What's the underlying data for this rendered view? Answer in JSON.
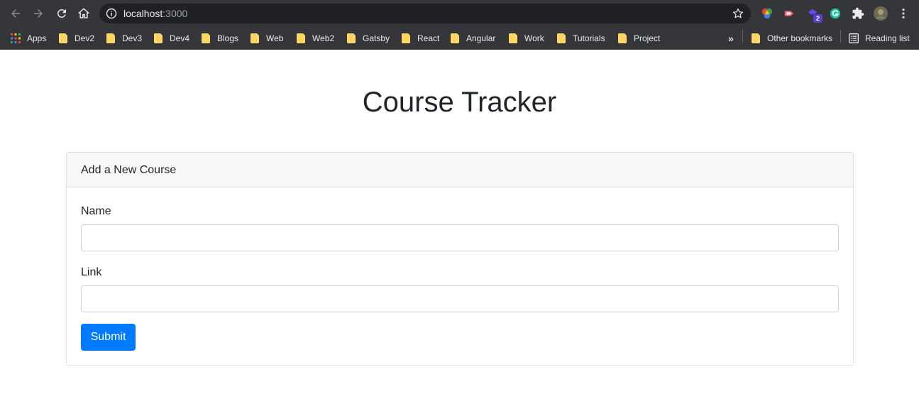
{
  "browser": {
    "url_host": "localhost",
    "url_port": ":3000",
    "extension_badge": "2",
    "bookmarks": [
      {
        "label": "Apps"
      },
      {
        "label": "Dev2"
      },
      {
        "label": "Dev3"
      },
      {
        "label": "Dev4"
      },
      {
        "label": "Blogs"
      },
      {
        "label": "Web"
      },
      {
        "label": "Web2"
      },
      {
        "label": "Gatsby"
      },
      {
        "label": "React"
      },
      {
        "label": "Angular"
      },
      {
        "label": "Work"
      },
      {
        "label": "Tutorials"
      },
      {
        "label": "Project"
      }
    ],
    "overflow_chevron": "»",
    "other_bookmarks": "Other bookmarks",
    "reading_list": "Reading list"
  },
  "page": {
    "title": "Course Tracker"
  },
  "form": {
    "header": "Add a New Course",
    "name_label": "Name",
    "name_value": "",
    "link_label": "Link",
    "link_value": "",
    "submit_label": "Submit"
  },
  "colors": {
    "chrome_bg": "#35363a",
    "omnibox_bg": "#202124",
    "primary_button": "#007bff",
    "folder": "#fdd663"
  }
}
